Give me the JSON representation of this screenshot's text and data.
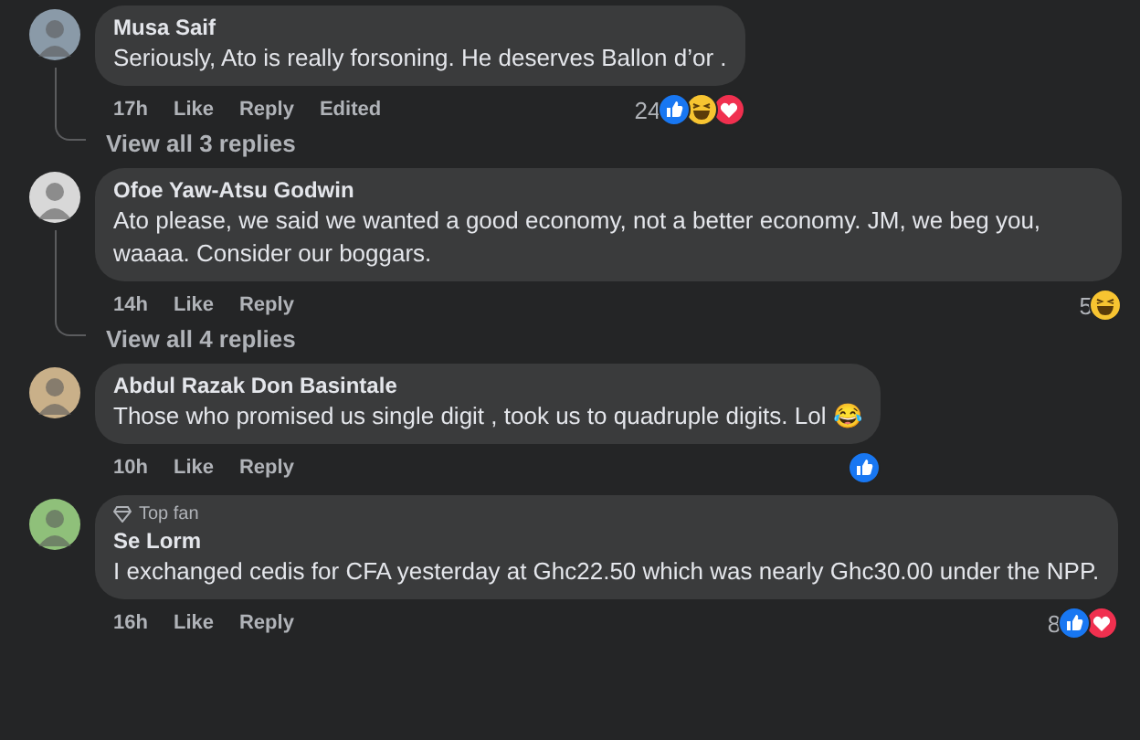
{
  "comments": [
    {
      "author": "Musa Saif",
      "text": "Seriously, Ato is really forsoning. He deserves Ballon d’or .",
      "time": "17h",
      "actions": [
        "Like",
        "Reply",
        "Edited"
      ],
      "reaction_count": "24",
      "reactions": [
        {
          "kind": "like"
        },
        {
          "kind": "haha"
        },
        {
          "kind": "love"
        }
      ],
      "view_replies": "View all 3 replies"
    },
    {
      "author": "Ofoe Yaw-Atsu Godwin",
      "text": "Ato please, we said we wanted a good economy, not a better economy. JM, we beg you, waaaa. Consider our boggars.",
      "time": "14h",
      "actions": [
        "Like",
        "Reply"
      ],
      "reaction_count": "5",
      "reactions": [
        {
          "kind": "haha"
        }
      ],
      "view_replies": "View all 4 replies"
    },
    {
      "author": "Abdul Razak Don Basintale",
      "text": "Those who promised us single digit , took us to quadruple digits. Lol 😂",
      "time": "10h",
      "actions": [
        "Like",
        "Reply"
      ],
      "reactions": [
        {
          "kind": "like"
        }
      ]
    },
    {
      "badge": "Top fan",
      "author": "Se Lorm",
      "text": "I exchanged cedis for CFA yesterday at Ghc22.50 which was nearly Ghc30.00 under the NPP.",
      "time": "16h",
      "actions": [
        "Like",
        "Reply"
      ],
      "reaction_count": "8",
      "reactions": [
        {
          "kind": "like"
        },
        {
          "kind": "love"
        }
      ]
    }
  ]
}
